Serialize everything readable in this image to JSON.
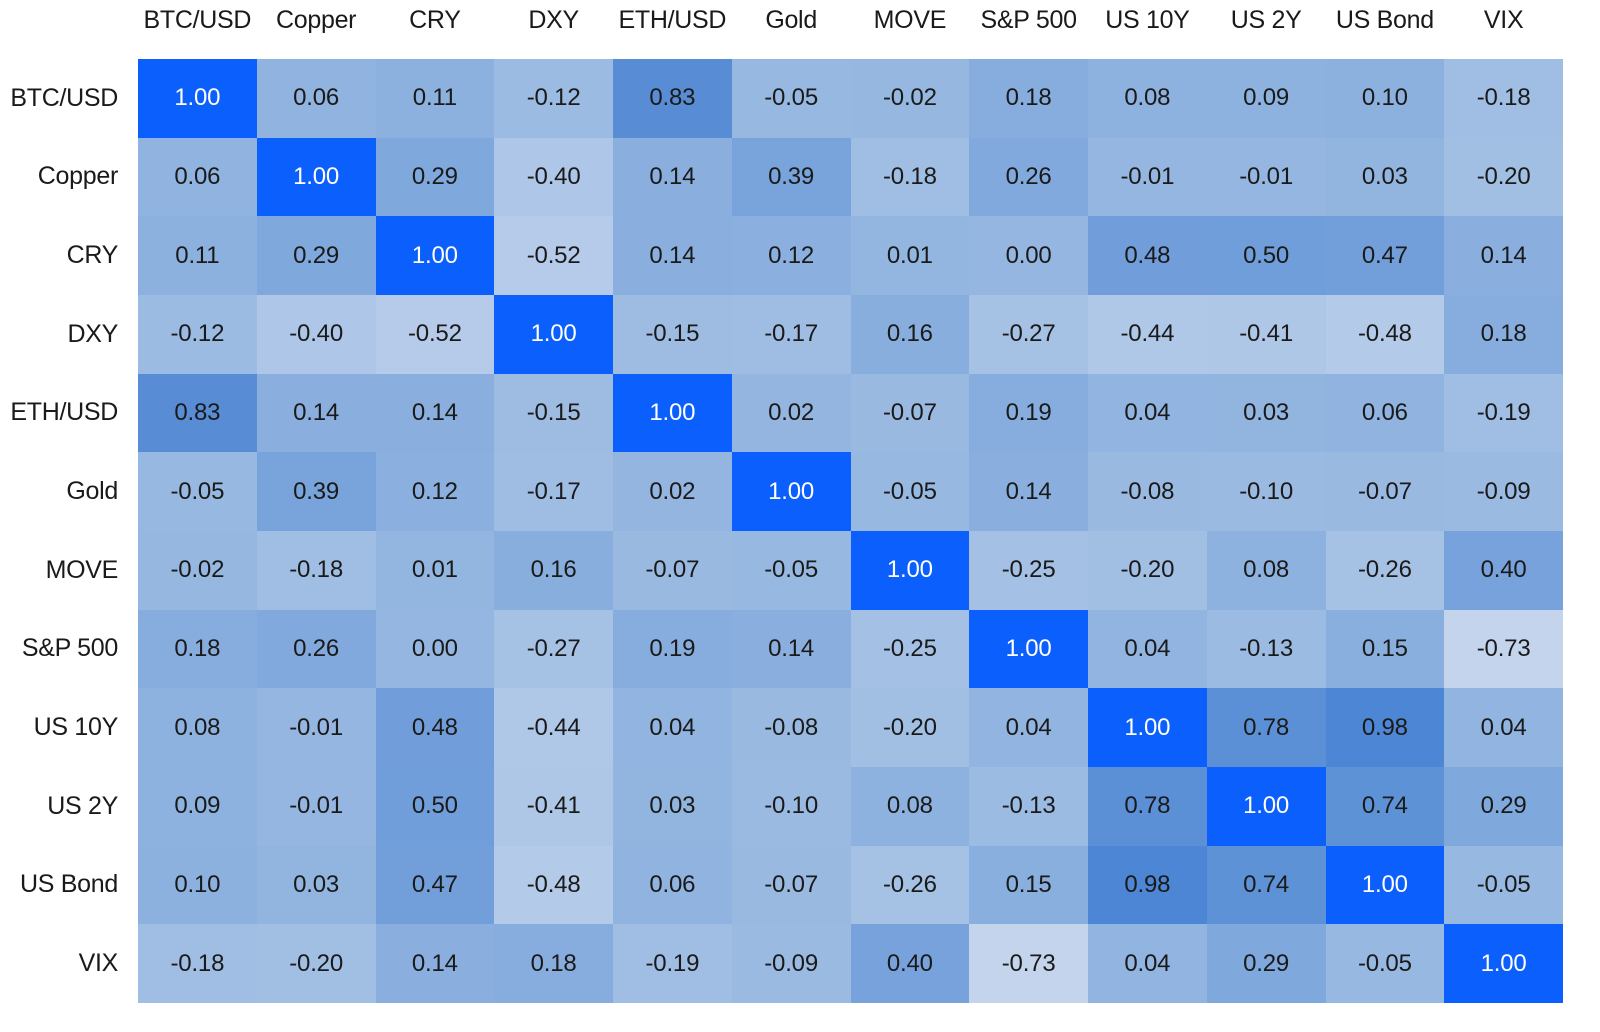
{
  "chart_data": {
    "type": "heatmap",
    "title": "",
    "subtitle": "",
    "xlabel": "",
    "ylabel": "",
    "grid": false,
    "legend": "none",
    "value_format": "2dp",
    "vmin": -0.73,
    "vmax": 1.0,
    "colorscale": {
      "low": "#c3d4ec",
      "mid": "#94b6e0",
      "high": "#4d86d4",
      "diagonal": "#0b5ffc",
      "text": "#1a1a1a",
      "text_on_diagonal": "#ffffff",
      "background": "#ffffff"
    },
    "categories": [
      "BTC/USD",
      "Copper",
      "CRY",
      "DXY",
      "ETH/USD",
      "Gold",
      "MOVE",
      "S&P 500",
      "US 10Y",
      "US 2Y",
      "US Bond",
      "VIX"
    ],
    "x_tick_labels": [
      "BTC/USD",
      "Copper",
      "CRY",
      "DXY",
      "ETH/USD",
      "Gold",
      "MOVE",
      "S&P 500",
      "US 10Y",
      "US 2Y",
      "US Bond",
      "VIX"
    ],
    "y_tick_labels": [
      "BTC/USD",
      "Copper",
      "CRY",
      "DXY",
      "ETH/USD",
      "Gold",
      "MOVE",
      "S&P 500",
      "US 10Y",
      "US 2Y",
      "US Bond",
      "VIX"
    ],
    "rows": [
      {
        "label": "BTC/USD",
        "values": [
          1.0,
          0.06,
          0.11,
          -0.12,
          0.83,
          -0.05,
          -0.02,
          0.18,
          0.08,
          0.09,
          0.1,
          -0.18
        ],
        "display": [
          "1.00",
          "0.06",
          "0.11",
          "-0.12",
          "0.83",
          "-0.05",
          "-0.02",
          "0.18",
          "0.08",
          "0.09",
          "0.10",
          "-0.18"
        ]
      },
      {
        "label": "Copper",
        "values": [
          0.06,
          1.0,
          0.29,
          -0.4,
          0.14,
          0.39,
          -0.18,
          0.26,
          -0.01,
          -0.01,
          0.03,
          -0.2
        ],
        "display": [
          "0.06",
          "1.00",
          "0.29",
          "-0.40",
          "0.14",
          "0.39",
          "-0.18",
          "0.26",
          "-0.01",
          "-0.01",
          "0.03",
          "-0.20"
        ]
      },
      {
        "label": "CRY",
        "values": [
          0.11,
          0.29,
          1.0,
          -0.52,
          0.14,
          0.12,
          0.01,
          0.0,
          0.48,
          0.5,
          0.47,
          0.14
        ],
        "display": [
          "0.11",
          "0.29",
          "1.00",
          "-0.52",
          "0.14",
          "0.12",
          "0.01",
          "0.00",
          "0.48",
          "0.50",
          "0.47",
          "0.14"
        ]
      },
      {
        "label": "DXY",
        "values": [
          -0.12,
          -0.4,
          -0.52,
          1.0,
          -0.15,
          -0.17,
          0.16,
          -0.27,
          -0.44,
          -0.41,
          -0.48,
          0.18
        ],
        "display": [
          "-0.12",
          "-0.40",
          "-0.52",
          "1.00",
          "-0.15",
          "-0.17",
          "0.16",
          "-0.27",
          "-0.44",
          "-0.41",
          "-0.48",
          "0.18"
        ]
      },
      {
        "label": "ETH/USD",
        "values": [
          0.83,
          0.14,
          0.14,
          -0.15,
          1.0,
          0.02,
          -0.07,
          0.19,
          0.04,
          0.03,
          0.06,
          -0.19
        ],
        "display": [
          "0.83",
          "0.14",
          "0.14",
          "-0.15",
          "1.00",
          "0.02",
          "-0.07",
          "0.19",
          "0.04",
          "0.03",
          "0.06",
          "-0.19"
        ]
      },
      {
        "label": "Gold",
        "values": [
          -0.05,
          0.39,
          0.12,
          -0.17,
          0.02,
          1.0,
          -0.05,
          0.14,
          -0.08,
          -0.1,
          -0.07,
          -0.09
        ],
        "display": [
          "-0.05",
          "0.39",
          "0.12",
          "-0.17",
          "0.02",
          "1.00",
          "-0.05",
          "0.14",
          "-0.08",
          "-0.10",
          "-0.07",
          "-0.09"
        ]
      },
      {
        "label": "MOVE",
        "values": [
          -0.02,
          -0.18,
          0.01,
          0.16,
          -0.07,
          -0.05,
          1.0,
          -0.25,
          -0.2,
          0.08,
          -0.26,
          0.4
        ],
        "display": [
          "-0.02",
          "-0.18",
          "0.01",
          "0.16",
          "-0.07",
          "-0.05",
          "1.00",
          "-0.25",
          "-0.20",
          "0.08",
          "-0.26",
          "0.40"
        ]
      },
      {
        "label": "S&P 500",
        "values": [
          0.18,
          0.26,
          0.0,
          -0.27,
          0.19,
          0.14,
          -0.25,
          1.0,
          0.04,
          -0.13,
          0.15,
          -0.73
        ],
        "display": [
          "0.18",
          "0.26",
          "0.00",
          "-0.27",
          "0.19",
          "0.14",
          "-0.25",
          "1.00",
          "0.04",
          "-0.13",
          "0.15",
          "-0.73"
        ]
      },
      {
        "label": "US 10Y",
        "values": [
          0.08,
          -0.01,
          0.48,
          -0.44,
          0.04,
          -0.08,
          -0.2,
          0.04,
          1.0,
          0.78,
          0.98,
          0.04
        ],
        "display": [
          "0.08",
          "-0.01",
          "0.48",
          "-0.44",
          "0.04",
          "-0.08",
          "-0.20",
          "0.04",
          "1.00",
          "0.78",
          "0.98",
          "0.04"
        ]
      },
      {
        "label": "US 2Y",
        "values": [
          0.09,
          -0.01,
          0.5,
          -0.41,
          0.03,
          -0.1,
          0.08,
          -0.13,
          0.78,
          1.0,
          0.74,
          0.29
        ],
        "display": [
          "0.09",
          "-0.01",
          "0.50",
          "-0.41",
          "0.03",
          "-0.10",
          "0.08",
          "-0.13",
          "0.78",
          "1.00",
          "0.74",
          "0.29"
        ]
      },
      {
        "label": "US Bond",
        "values": [
          0.1,
          0.03,
          0.47,
          -0.48,
          0.06,
          -0.07,
          -0.26,
          0.15,
          0.98,
          0.74,
          1.0,
          -0.05
        ],
        "display": [
          "0.10",
          "0.03",
          "0.47",
          "-0.48",
          "0.06",
          "-0.07",
          "-0.26",
          "0.15",
          "0.98",
          "0.74",
          "1.00",
          "-0.05"
        ]
      },
      {
        "label": "VIX",
        "values": [
          -0.18,
          -0.2,
          0.14,
          0.18,
          -0.19,
          -0.09,
          0.4,
          -0.73,
          0.04,
          0.29,
          -0.05,
          1.0
        ],
        "display": [
          "-0.18",
          "-0.20",
          "0.14",
          "0.18",
          "-0.19",
          "-0.09",
          "0.40",
          "-0.73",
          "0.04",
          "0.29",
          "-0.05",
          "1.00"
        ]
      }
    ]
  }
}
